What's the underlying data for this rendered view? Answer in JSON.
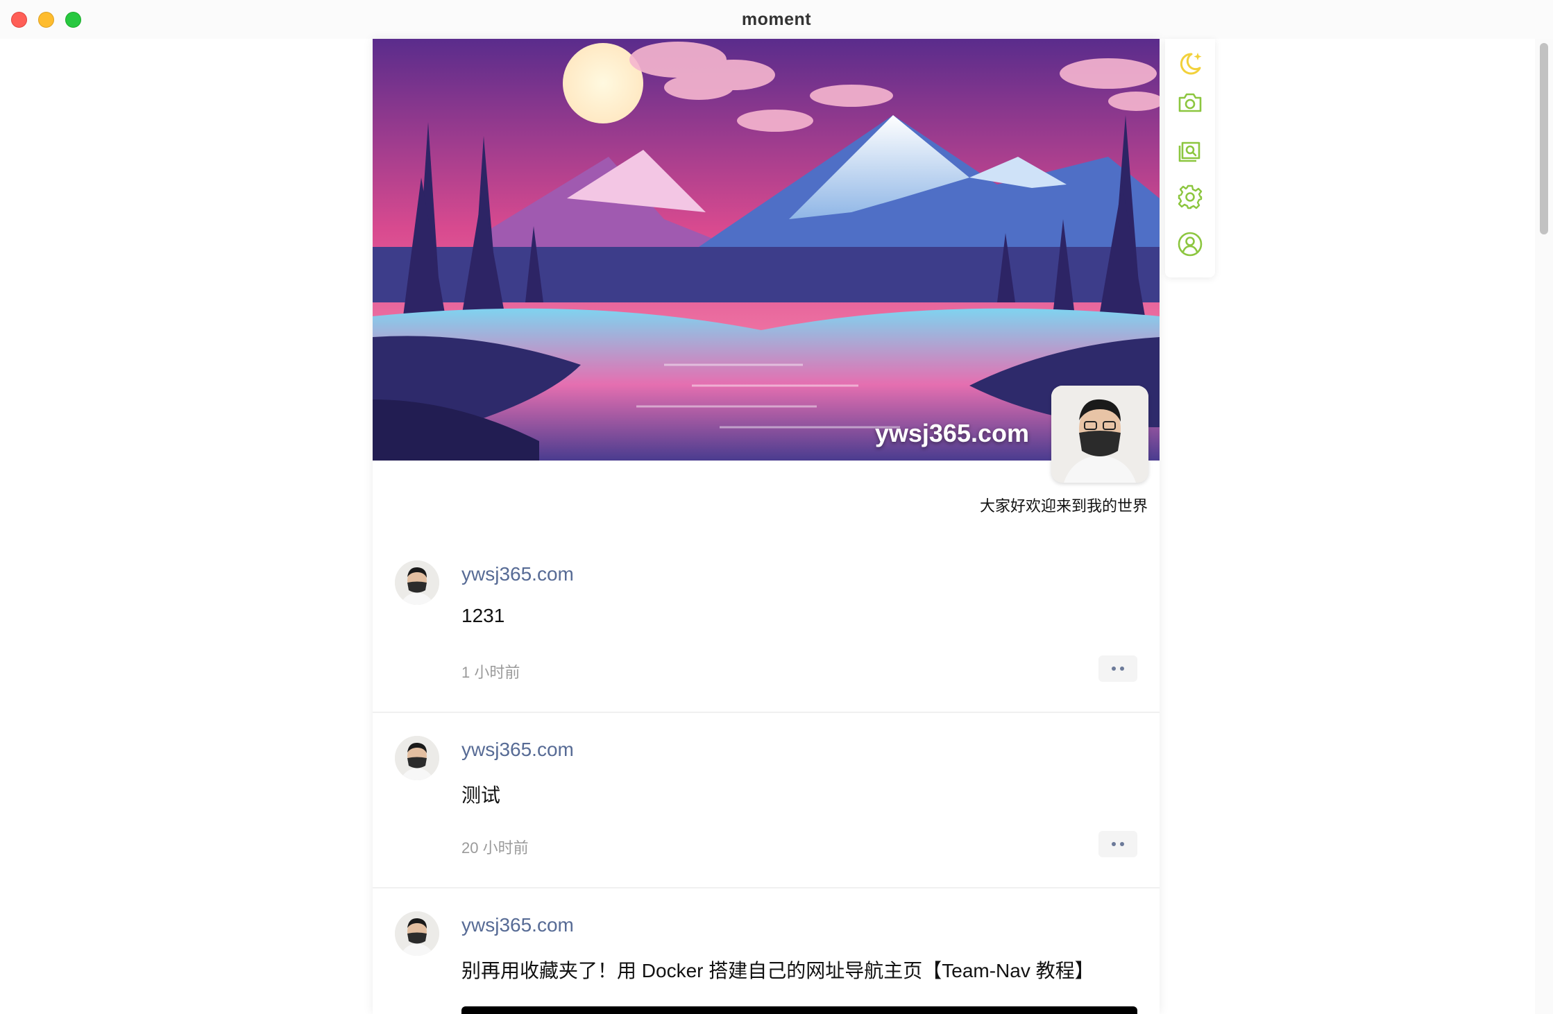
{
  "window": {
    "title": "moment"
  },
  "cover": {
    "site_name": "ywsj365.com",
    "signature": "大家好欢迎来到我的世界"
  },
  "toolbar": {
    "icons": [
      "moon-icon",
      "camera-icon",
      "image-search-icon",
      "gear-icon",
      "user-circle-icon"
    ],
    "accent_color": "#8cc63f",
    "moon_color": "#f2d13b"
  },
  "posts": [
    {
      "author": "ywsj365.com",
      "content": "1231",
      "time": "1 小时前"
    },
    {
      "author": "ywsj365.com",
      "content": "测试",
      "time": "20 小时前"
    },
    {
      "author": "ywsj365.com",
      "content": "别再用收藏夹了！用 Docker 搭建自己的网址导航主页【Team-Nav 教程】"
    }
  ],
  "colors": {
    "author_link": "#576b95",
    "timestamp": "#9a9a9a"
  }
}
